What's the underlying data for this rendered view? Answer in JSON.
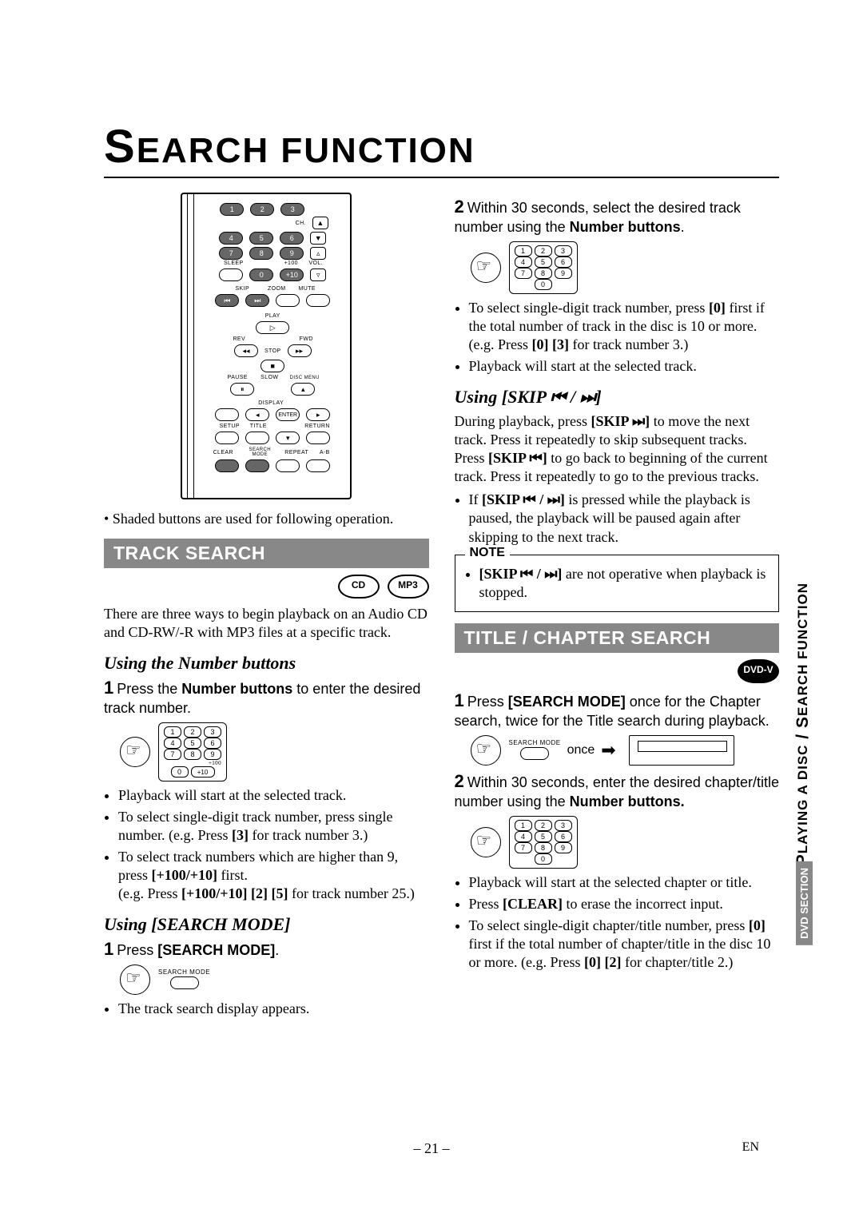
{
  "title_parts": {
    "s": "S",
    "rest": "EARCH FUNCTION"
  },
  "remote": {
    "rows": [
      [
        "1",
        "2",
        "3"
      ],
      [
        "4",
        "5",
        "6"
      ],
      [
        "7",
        "8",
        "9"
      ],
      [
        "",
        "0",
        "+10"
      ]
    ],
    "row3_labels": {
      "left": "SLEEP",
      "right": "+100"
    },
    "ch_label": "CH.",
    "vol_label": "VOL.",
    "row4_labels": {
      "skip": "SKIP",
      "zoom": "ZOOM",
      "mute": "MUTE"
    },
    "play": "PLAY",
    "rev": "REV",
    "fwd": "FWD",
    "stop": "STOP",
    "pause": "PAUSE",
    "slow": "SLOW",
    "disc_menu": "DISC MENU",
    "display": "DISPLAY",
    "enter": "ENTER",
    "setup": "SETUP",
    "title": "TITLE",
    "return": "RETURN",
    "clear": "CLEAR",
    "searchmode": "SEARCH MODE",
    "repeat": "REPEAT",
    "ab": "A-B"
  },
  "remote_caption": "• Shaded buttons are used for following operation.",
  "track_search_heading": "TRACK SEARCH",
  "badges": {
    "cd": "CD",
    "mp3": "MP3",
    "dvd": "DVD-V"
  },
  "intro": "There are three ways to begin playback on an Audio CD and CD-RW/-R with MP3 files at a specific track.",
  "sub_number": "Using the Number buttons",
  "step1a_pre": "Press the ",
  "step1a_bold": "Number buttons",
  "step1a_post": " to enter the desired track number.",
  "keypad_a": [
    [
      "1",
      "2",
      "3"
    ],
    [
      "4",
      "5",
      "6"
    ],
    [
      "7",
      "8",
      "9"
    ],
    [
      "0",
      "+10"
    ]
  ],
  "keypad_a_extra": "+100",
  "bullets_a": [
    "Playback will start at the selected track.",
    "To select single-digit track number, press single number. (e.g. Press [3] for track number 3.)",
    "To select track numbers which are higher than 9, press [+100/+10] first. (e.g. Press [+100/+10] [2] [5] for track number 25.)"
  ],
  "sub_searchmode": "Using [SEARCH MODE]",
  "step1b": "Press ",
  "step1b_bold": "[SEARCH MODE]",
  "step1b_period": ".",
  "sm_label": "SEARCH MODE",
  "bullet_b": "The track search display appears.",
  "step2_pre": "Within 30 seconds, select the desired track number using the ",
  "step2_bold": "Number buttons",
  "step2_post": ".",
  "keypad_b": [
    [
      "1",
      "2",
      "3"
    ],
    [
      "4",
      "5",
      "6"
    ],
    [
      "7",
      "8",
      "9"
    ],
    [
      "0"
    ]
  ],
  "bullets_c": [
    "To select single-digit track number, press [0] first if the total number of track in the disc is 10 or more. (e.g. Press [0] [3] for track number 3.)",
    "Playback will start at the selected track."
  ],
  "sub_skip": "Using [SKIP ⏮ / ⏭]",
  "skip_para": "During playback, press [SKIP ⏭] to move the next track. Press it repeatedly to skip subsequent tracks. Press [SKIP ⏮] to go back to beginning of the current track. Press it repeatedly to go to the previous tracks.",
  "skip_bullet": "If [SKIP ⏮ / ⏭] is pressed while the playback is paused, the playback will be paused again after skipping to the next track.",
  "note_label": "NOTE",
  "note_text": "[SKIP ⏮ / ⏭] are not operative when playback is stopped.",
  "title_search_heading": "TITLE / CHAPTER SEARCH",
  "tc_step1_pre": "Press ",
  "tc_step1_bold": "[SEARCH MODE]",
  "tc_step1_post": " once for the Chapter search, twice for the Title search during playback.",
  "once_label": "once",
  "tc_step2_pre": "Within 30 seconds, enter the desired chapter/title number using the ",
  "tc_step2_bold": "Number buttons.",
  "tc_bullets": [
    "Playback will start at the selected chapter or title.",
    "Press [CLEAR] to erase the incorrect input.",
    "To select single-digit chapter/title number, press [0] first if the total number of chapter/title in the disc 10 or more. (e.g. Press [0] [2] for chapter/title 2.)"
  ],
  "side_top_parts": {
    "pre": "P",
    "mid": "LAYING A DISC",
    "sep": " / ",
    "s": "S",
    "post": "EARCH FUNCTION"
  },
  "side_bottom": "DVD SECTION",
  "page_num": "– 21 –",
  "lang": "EN"
}
